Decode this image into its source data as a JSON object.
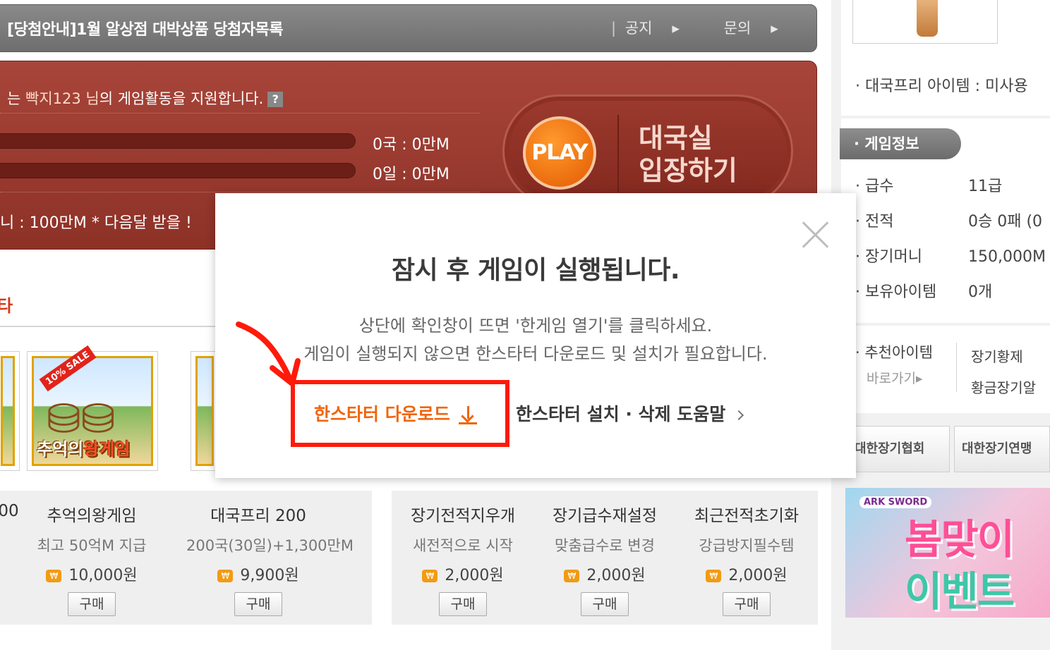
{
  "notice": {
    "headline": "[당첨안내]1월 알상점 대박상품 당첨자목록",
    "link_notice": "공지",
    "link_inquiry": "문의",
    "sep": "|",
    "arrow": "▸"
  },
  "support": {
    "prefix": "는 ",
    "nickname": "빡지123 님",
    "message": "의 게임활동을 지원합니다.",
    "help": "?",
    "row1": "0국 :   0만M",
    "row2": "0일 :   0만M",
    "money": "니 : 100만M   * 다음달 받을 !"
  },
  "play": {
    "circle": "PLAY",
    "label_line1": "대국실",
    "label_line2": "입장하기"
  },
  "section": {
    "title": "타"
  },
  "thumbs": {
    "sale": "10% SALE",
    "title_a": "추억의",
    "title_b": "왕게임"
  },
  "goods": [
    {
      "name": "00",
      "desc": "",
      "price": ""
    },
    {
      "name": "추억의왕게임",
      "desc": "최고 50억M 지급",
      "price": "10,000원",
      "buy": "구매"
    },
    {
      "name": "대국프리 200",
      "desc": "200국(30일)+1,300만M",
      "price": "9,900원",
      "buy": "구매"
    },
    {
      "name": "장기전적지우개",
      "desc": "새전적으로 시작",
      "price": "2,000원",
      "buy": "구매"
    },
    {
      "name": "장기급수재설정",
      "desc": "맞춤급수로 변경",
      "price": "2,000원",
      "buy": "구매"
    },
    {
      "name": "최근전적초기화",
      "desc": "강급방지필수템",
      "price": "2,000원",
      "buy": "구매"
    }
  ],
  "won_icon": "₩",
  "sidebar": {
    "free_item": "· 대국프리 아이템 : 미사용",
    "gameinfo_tab": "· 게임정보",
    "info": [
      {
        "k": "· 급수",
        "v": "11급"
      },
      {
        "k": "· 전적",
        "v": "0승 0패 (0"
      },
      {
        "k": "· 장기머니",
        "v": "150,000M"
      },
      {
        "k": "· 보유아이템",
        "v": "0개"
      }
    ],
    "rec_label": "· 추천아이템",
    "rec_link": "바로가기▸",
    "rec_item1": "장기황제",
    "rec_item2": "황금장기알",
    "assoc1": "대한장기협회",
    "assoc2": "대한장기연맹",
    "banner_logo": "ARK SWORD",
    "banner_t1": "봄맞이",
    "banner_t2": "이벤트"
  },
  "modal": {
    "title": "잠시 후 게임이 실행됩니다.",
    "desc1": "상단에 확인창이 뜨면 '한게임 열기'를 클릭하세요.",
    "desc2": "게임이 실행되지 않으면 한스타터 다운로드 및 설치가 필요합니다.",
    "download": "한스타터 다운로드",
    "help": "한스타터 설치 · 삭제 도움말"
  },
  "colors": {
    "accent_orange": "#f0650c",
    "highlight_red": "#ff1a0a",
    "panel_red": "#8d3127"
  }
}
